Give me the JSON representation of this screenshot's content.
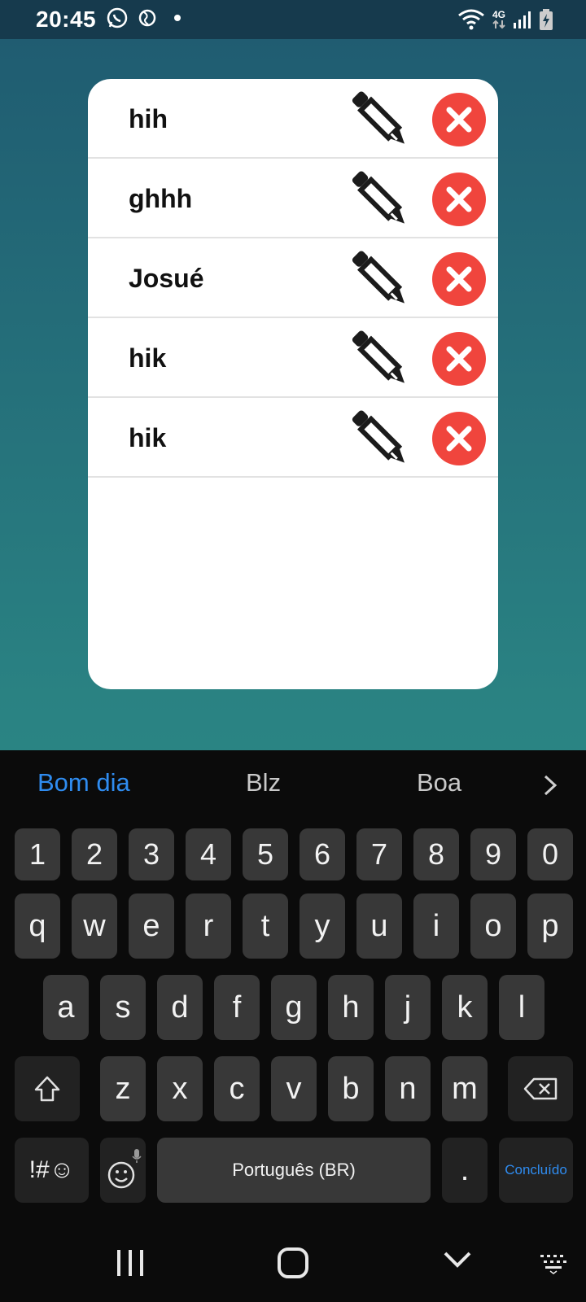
{
  "status_bar": {
    "time": "20:45",
    "left_icons": [
      "whatsapp-icon",
      "vpn-globe-icon",
      "dot-icon"
    ],
    "network_label_top": "4G",
    "right_icons": [
      "wifi-icon",
      "mobile-data-icon",
      "signal-icon",
      "battery-charging-icon"
    ]
  },
  "list": {
    "items": [
      {
        "label": "hih"
      },
      {
        "label": "ghhh"
      },
      {
        "label": "Josué"
      },
      {
        "label": "hik"
      },
      {
        "label": "hik"
      }
    ],
    "edit_icon": "pencil-icon",
    "delete_icon": "close-circle-icon",
    "colors": {
      "delete": "#f0453d",
      "card": "#ffffff",
      "text": "#111111"
    }
  },
  "keyboard": {
    "suggestions": [
      "Bom dia",
      "Blz",
      "Boa"
    ],
    "number_row": [
      "1",
      "2",
      "3",
      "4",
      "5",
      "6",
      "7",
      "8",
      "9",
      "0"
    ],
    "row1": [
      "q",
      "w",
      "e",
      "r",
      "t",
      "y",
      "u",
      "i",
      "o",
      "p"
    ],
    "row2": [
      "a",
      "s",
      "d",
      "f",
      "g",
      "h",
      "j",
      "k",
      "l"
    ],
    "row3": [
      "z",
      "x",
      "c",
      "v",
      "b",
      "n",
      "m"
    ],
    "symbols_label": "!#☺",
    "space_label": "Português (BR)",
    "period_label": ".",
    "done_label": "Concluído",
    "accent": "#2f8cf0"
  },
  "nav": [
    "recents-icon",
    "home-icon",
    "back-chevron-icon",
    "keyboard-switch-icon"
  ]
}
